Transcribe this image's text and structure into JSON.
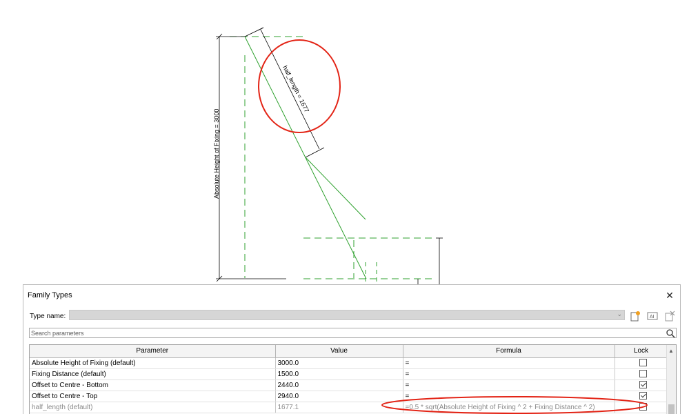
{
  "drawing": {
    "half_length_label": "half_length = 1677",
    "height_label": "Absolute Height of Fixing = 3000"
  },
  "dialog": {
    "title": "Family Types",
    "close_glyph": "✕",
    "type_name_label": "Type name:",
    "type_name_value": "",
    "search_placeholder": "Search parameters",
    "columns": [
      "Parameter",
      "Value",
      "Formula",
      "Lock"
    ],
    "rows": [
      {
        "parameter": "Absolute Height of Fixing (default)",
        "value": "3000.0",
        "formula": "=",
        "locked": false
      },
      {
        "parameter": "Fixing Distance (default)",
        "value": "1500.0",
        "formula": "=",
        "locked": false
      },
      {
        "parameter": "Offset to Centre - Bottom",
        "value": "2440.0",
        "formula": "=",
        "locked": true
      },
      {
        "parameter": "Offset to Centre - Top",
        "value": "2940.0",
        "formula": "=",
        "locked": true
      },
      {
        "parameter": "half_length (default)",
        "value": "1677.1",
        "formula": "=0.5 * sqrt(Absolute Height of Fixing ^ 2 + Fixing Distance ^ 2)",
        "locked": false
      }
    ]
  },
  "colors": {
    "highlight": "#e32416",
    "reference_line": "#2fa12f"
  },
  "icons": [
    "new-type-icon",
    "rename-type-icon",
    "delete-type-icon",
    "search-icon",
    "close-icon"
  ]
}
